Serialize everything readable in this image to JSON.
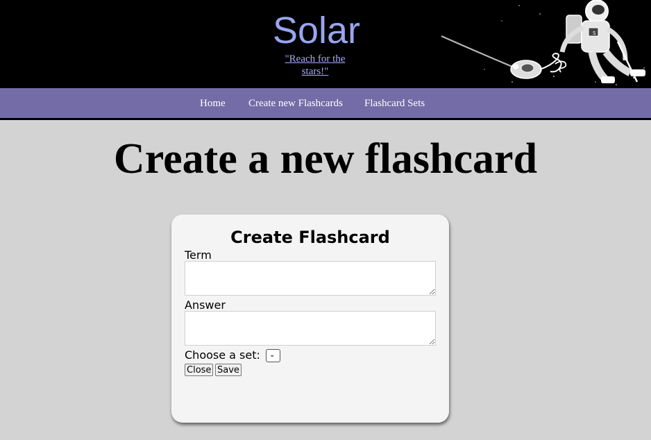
{
  "header": {
    "brand": "Solar",
    "tagline": "\"Reach for the stars!\""
  },
  "nav": {
    "items": [
      {
        "label": "Home"
      },
      {
        "label": "Create new Flashcards"
      },
      {
        "label": "Flashcard Sets"
      }
    ]
  },
  "main": {
    "title": "Create a new flashcard"
  },
  "form": {
    "title": "Create Flashcard",
    "term_label": "Term",
    "term_value": "",
    "answer_label": "Answer",
    "answer_value": "",
    "set_label": "Choose a set:",
    "set_value": "",
    "close_label": "Close",
    "save_label": "Save"
  },
  "icons": {
    "astronaut": "astronaut-vacuum-illustration",
    "select_arrow": "chevron-down-icon"
  },
  "colors": {
    "header_bg": "#000000",
    "brand": "#98a5ee",
    "nav_bg": "#736ca7",
    "page_bg": "#d3d3d3",
    "card_bg": "#f4f4f4"
  }
}
